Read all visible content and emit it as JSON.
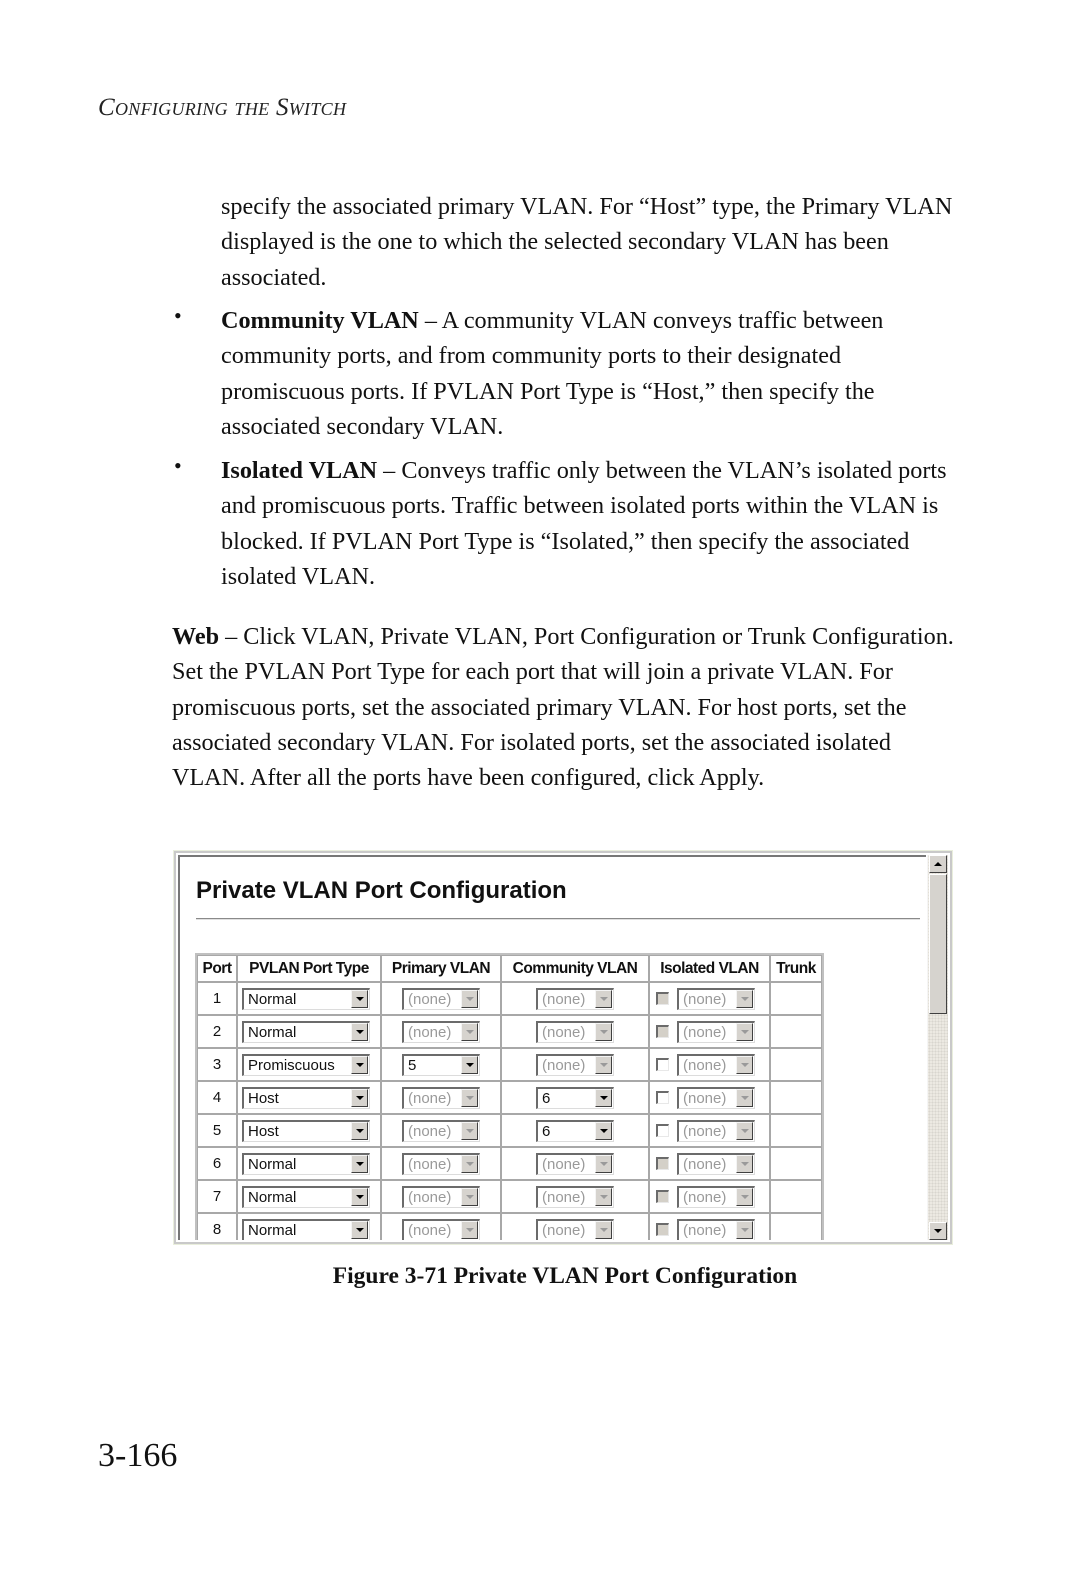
{
  "running_head": "Configuring the Switch",
  "intro_paragraph": "specify the associated primary VLAN. For “Host” type, the Primary VLAN displayed is the one to which the selected secondary VLAN has been associated.",
  "bullets": [
    {
      "term": "Community VLAN",
      "separator": " – ",
      "text": "A community VLAN conveys traffic between community ports, and from community ports to their designated promiscuous ports. If PVLAN Port Type is “Host,” then specify the associated secondary VLAN."
    },
    {
      "term": "Isolated VLAN",
      "separator": " – ",
      "text": "Conveys traffic only between the VLAN’s isolated ports and promiscuous ports. Traffic between isolated ports within the VLAN is blocked. If PVLAN Port Type is “Isolated,” then specify the associated isolated VLAN."
    }
  ],
  "bullet_glyph": "•",
  "web_paragraph": {
    "term": "Web",
    "separator": " – ",
    "text": "Click VLAN, Private VLAN, Port Configuration or Trunk Configuration. Set the PVLAN Port Type for each port that will join a private VLAN. For promiscuous ports, set the associated primary VLAN. For host ports, set the associated secondary VLAN. For isolated ports, set the associated isolated VLAN. After all the ports have been configured, click Apply."
  },
  "screenshot": {
    "title": "Private VLAN Port Configuration",
    "columns": [
      "Port",
      "PVLAN Port Type",
      "Primary VLAN",
      "Community VLAN",
      "Isolated VLAN",
      "Trunk"
    ],
    "rows": [
      {
        "port": "1",
        "type": "Normal",
        "primary": "(none)",
        "primary_enabled": false,
        "community": "(none)",
        "community_enabled": false,
        "isolated_checked": false,
        "isolated_check_enabled": false,
        "isolated": "(none)",
        "isolated_enabled": false,
        "trunk": ""
      },
      {
        "port": "2",
        "type": "Normal",
        "primary": "(none)",
        "primary_enabled": false,
        "community": "(none)",
        "community_enabled": false,
        "isolated_checked": false,
        "isolated_check_enabled": false,
        "isolated": "(none)",
        "isolated_enabled": false,
        "trunk": ""
      },
      {
        "port": "3",
        "type": "Promiscuous",
        "primary": "5",
        "primary_enabled": true,
        "community": "(none)",
        "community_enabled": false,
        "isolated_checked": false,
        "isolated_check_enabled": true,
        "isolated": "(none)",
        "isolated_enabled": false,
        "trunk": ""
      },
      {
        "port": "4",
        "type": "Host",
        "primary": "(none)",
        "primary_enabled": false,
        "community": "6",
        "community_enabled": true,
        "isolated_checked": false,
        "isolated_check_enabled": true,
        "isolated": "(none)",
        "isolated_enabled": false,
        "trunk": ""
      },
      {
        "port": "5",
        "type": "Host",
        "primary": "(none)",
        "primary_enabled": false,
        "community": "6",
        "community_enabled": true,
        "isolated_checked": false,
        "isolated_check_enabled": true,
        "isolated": "(none)",
        "isolated_enabled": false,
        "trunk": ""
      },
      {
        "port": "6",
        "type": "Normal",
        "primary": "(none)",
        "primary_enabled": false,
        "community": "(none)",
        "community_enabled": false,
        "isolated_checked": false,
        "isolated_check_enabled": false,
        "isolated": "(none)",
        "isolated_enabled": false,
        "trunk": ""
      },
      {
        "port": "7",
        "type": "Normal",
        "primary": "(none)",
        "primary_enabled": false,
        "community": "(none)",
        "community_enabled": false,
        "isolated_checked": false,
        "isolated_check_enabled": false,
        "isolated": "(none)",
        "isolated_enabled": false,
        "trunk": ""
      },
      {
        "port": "8",
        "type": "Normal",
        "primary": "(none)",
        "primary_enabled": false,
        "community": "(none)",
        "community_enabled": false,
        "isolated_checked": false,
        "isolated_check_enabled": false,
        "isolated": "(none)",
        "isolated_enabled": false,
        "trunk": ""
      }
    ],
    "scrollbar": {
      "up_icon": "scroll-up-arrow",
      "down_icon": "scroll-down-arrow",
      "scroll_position_fraction": 0.0
    }
  },
  "figure_caption": "Figure 3-71  Private VLAN Port Configuration",
  "page_number": "3-166"
}
